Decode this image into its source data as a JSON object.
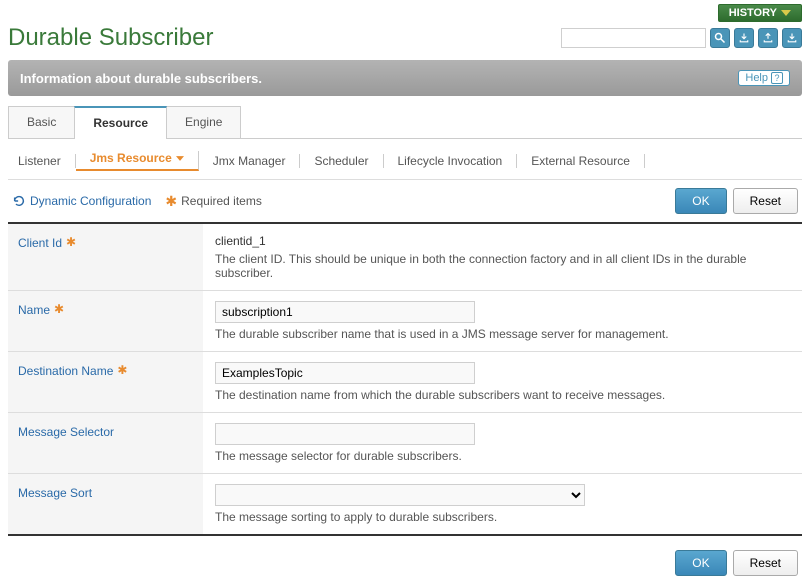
{
  "header": {
    "history_label": "HISTORY",
    "title": "Durable Subscriber",
    "search_placeholder": ""
  },
  "info_bar": {
    "text": "Information about durable subscribers.",
    "help_label": "Help"
  },
  "tabs_primary": [
    {
      "label": "Basic",
      "active": false
    },
    {
      "label": "Resource",
      "active": true
    },
    {
      "label": "Engine",
      "active": false
    }
  ],
  "tabs_secondary": [
    {
      "label": "Listener",
      "active": false
    },
    {
      "label": "Jms Resource",
      "active": true
    },
    {
      "label": "Jmx Manager",
      "active": false
    },
    {
      "label": "Scheduler",
      "active": false
    },
    {
      "label": "Lifecycle Invocation",
      "active": false
    },
    {
      "label": "External Resource",
      "active": false
    }
  ],
  "toolbar": {
    "dynamic_config": "Dynamic Configuration",
    "required_items": "Required items",
    "ok_label": "OK",
    "reset_label": "Reset"
  },
  "fields": {
    "client_id": {
      "label": "Client Id",
      "required": true,
      "value": "clientid_1",
      "desc": "The client ID. This should be unique in both the connection factory and in all client IDs in the durable subscriber."
    },
    "name": {
      "label": "Name",
      "required": true,
      "value": "subscription1",
      "desc": "The durable subscriber name that is used in a JMS message server for management."
    },
    "destination_name": {
      "label": "Destination Name",
      "required": true,
      "value": "ExamplesTopic",
      "desc": "The destination name from which the durable subscribers want to receive messages."
    },
    "message_selector": {
      "label": "Message Selector",
      "required": false,
      "value": "",
      "desc": "The message selector for durable subscribers."
    },
    "message_sort": {
      "label": "Message Sort",
      "required": false,
      "value": "",
      "desc": "The message sorting to apply to durable subscribers."
    }
  },
  "bottom": {
    "ok_label": "OK",
    "reset_label": "Reset"
  }
}
